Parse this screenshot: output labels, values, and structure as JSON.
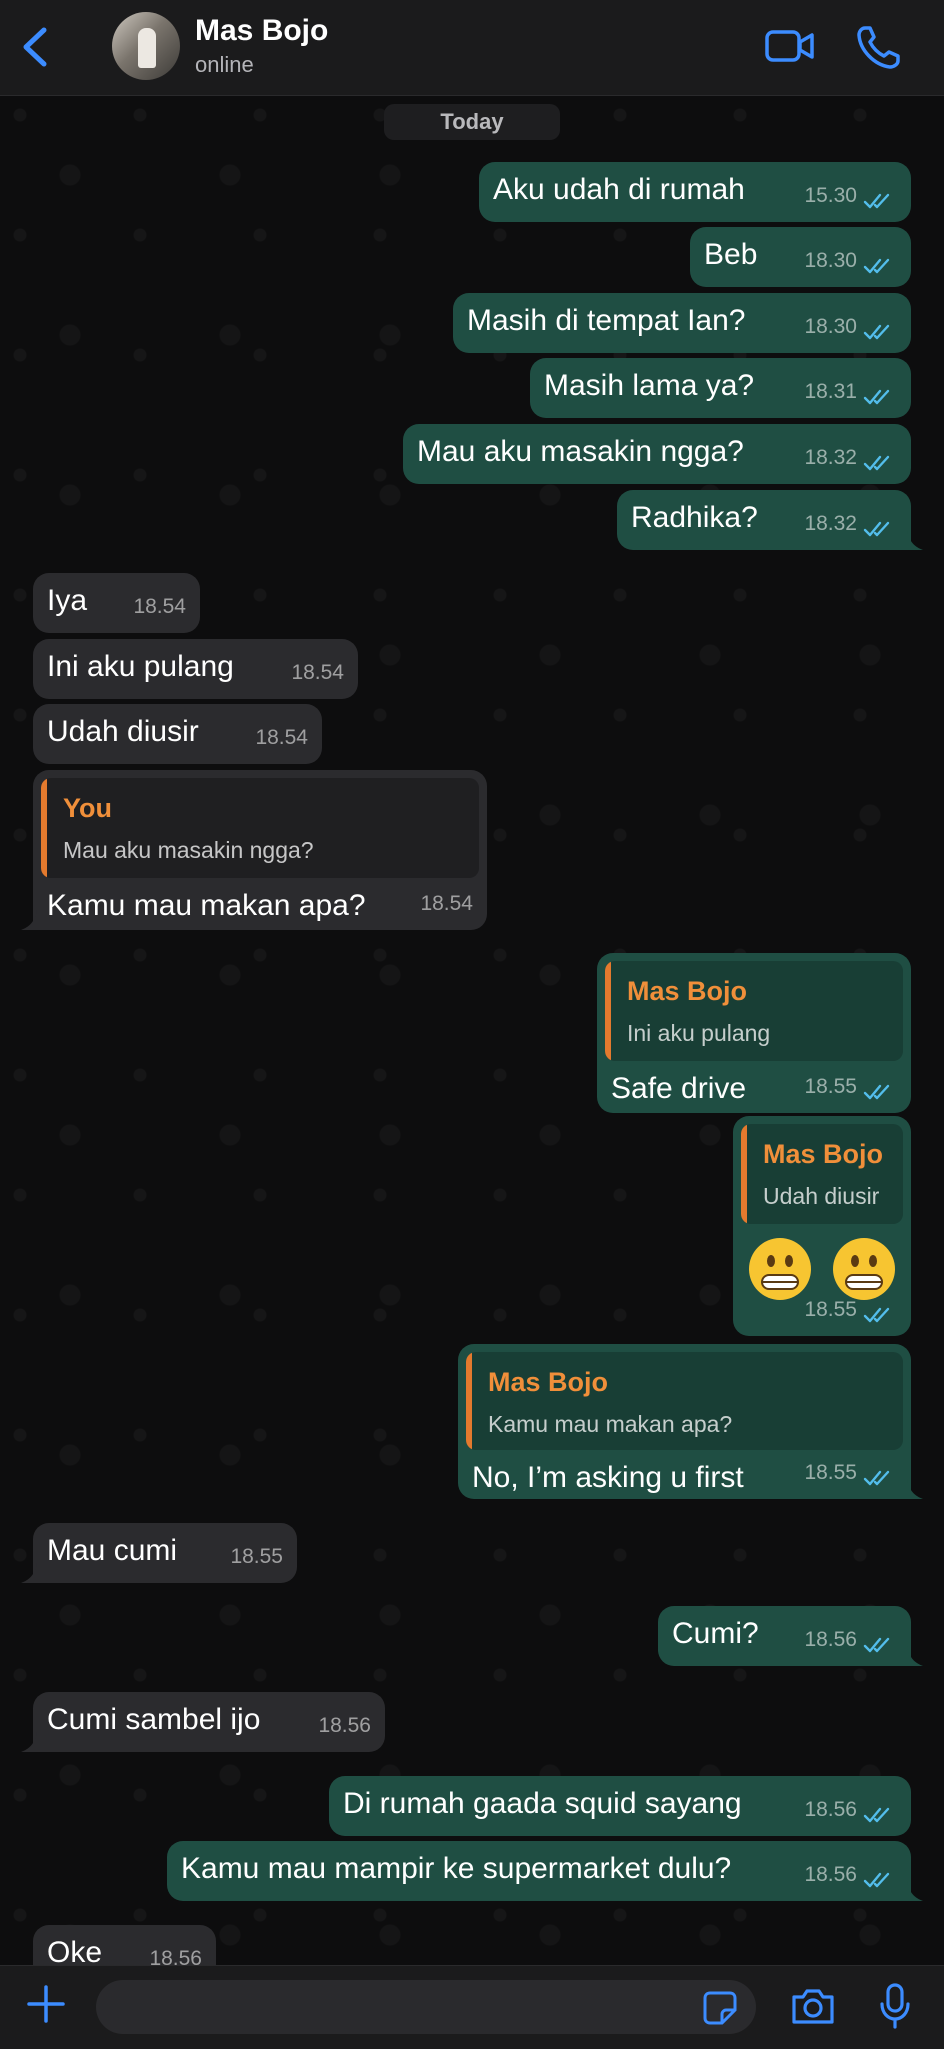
{
  "header": {
    "contact_name": "Mas Bojo",
    "status": "online"
  },
  "date_divider": "Today",
  "messages": [
    {
      "dir": "out",
      "text": "Aku udah di rumah",
      "time": "15.30"
    },
    {
      "dir": "out",
      "text": "Beb",
      "time": "18.30"
    },
    {
      "dir": "out",
      "text": "Masih di tempat Ian?",
      "time": "18.30"
    },
    {
      "dir": "out",
      "text": "Masih lama ya?",
      "time": "18.31"
    },
    {
      "dir": "out",
      "text": "Mau aku masakin ngga?",
      "time": "18.32"
    },
    {
      "dir": "out",
      "text": "Radhika?",
      "time": "18.32"
    },
    {
      "dir": "in",
      "text": "Iya",
      "time": "18.54"
    },
    {
      "dir": "in",
      "text": "Ini aku pulang",
      "time": "18.54"
    },
    {
      "dir": "in",
      "text": "Udah diusir",
      "time": "18.54"
    },
    {
      "dir": "in",
      "quote_name": "You",
      "quote_text": "Mau aku masakin ngga?",
      "text": "Kamu mau makan apa?",
      "time": "18.54"
    },
    {
      "dir": "out",
      "quote_name": "Mas Bojo",
      "quote_text": "Ini aku pulang",
      "text": "Safe drive",
      "time": "18.55"
    },
    {
      "dir": "out",
      "quote_name": "Mas Bojo",
      "quote_text": "Udah diusir",
      "text": "😬 😬",
      "time": "18.55"
    },
    {
      "dir": "out",
      "quote_name": "Mas Bojo",
      "quote_text": "Kamu mau makan apa?",
      "text": "No, I’m asking u first",
      "time": "18.55"
    },
    {
      "dir": "in",
      "text": "Mau cumi",
      "time": "18.55"
    },
    {
      "dir": "out",
      "text": "Cumi?",
      "time": "18.56"
    },
    {
      "dir": "in",
      "text": "Cumi sambel ijo",
      "time": "18.56"
    },
    {
      "dir": "out",
      "text": "Di rumah gaada squid sayang",
      "time": "18.56"
    },
    {
      "dir": "out",
      "text": "Kamu mau mampir ke supermarket dulu?",
      "time": "18.56"
    },
    {
      "dir": "in",
      "text": "Oke",
      "time": "18.56"
    }
  ],
  "composer": {
    "placeholder": ""
  },
  "colors": {
    "accent": "#3c8cff",
    "outgoing_bubble": "#1f4e43",
    "incoming_bubble": "#2b2b2e",
    "quote_name": "#f08f3a",
    "read_ticks": "#53bdeb"
  },
  "icons": [
    "back-chevron-icon",
    "video-call-icon",
    "phone-icon",
    "plus-icon",
    "sticker-icon",
    "camera-icon",
    "microphone-icon",
    "double-check-icon"
  ]
}
